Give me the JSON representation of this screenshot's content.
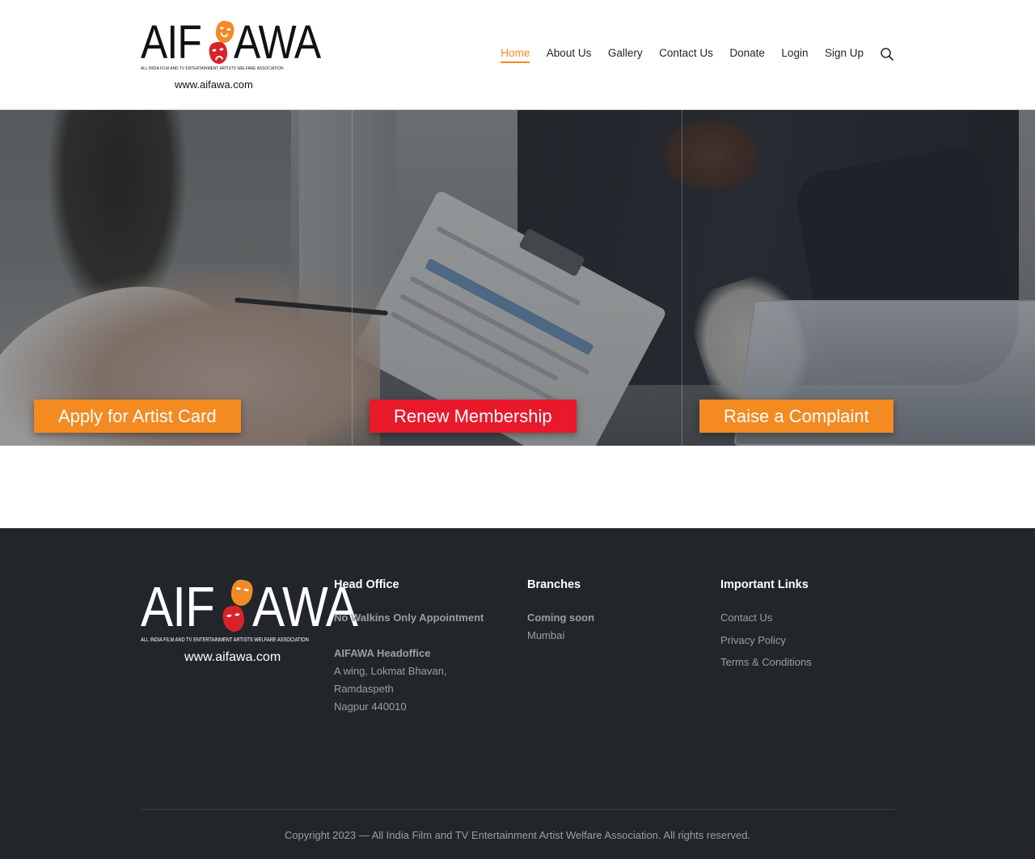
{
  "brand": {
    "logo_left": "AIF",
    "logo_right": "AWA",
    "tagline": "ALL INDIA FILM AND TV ENTERTAINMENT ARTISTS WELFARE ASSOCIATION",
    "url": "www.aifawa.com",
    "mask_colors": [
      "#f28a25",
      "#d8222a"
    ]
  },
  "nav": {
    "items": [
      {
        "label": "Home",
        "active": true
      },
      {
        "label": "About Us"
      },
      {
        "label": "Gallery"
      },
      {
        "label": "Contact Us"
      },
      {
        "label": "Donate"
      },
      {
        "label": "Login"
      },
      {
        "label": "Sign Up"
      }
    ],
    "search_icon": "search-icon",
    "active_color": "#f28a25"
  },
  "hero": {
    "buttons": [
      {
        "label": "Apply for Artist Card",
        "color": "#f38a22"
      },
      {
        "label": "Renew Membership",
        "color": "#e8192b"
      },
      {
        "label": "Raise a Complaint",
        "color": "#f38a22"
      }
    ]
  },
  "footer": {
    "head_office": {
      "title": "Head Office",
      "note": "No Walkins Only Appointment",
      "name": "AIFAWA Headoffice",
      "address": [
        "A wing, Lokmat Bhavan,",
        "Ramdaspeth",
        "Nagpur 440010"
      ]
    },
    "branches": {
      "title": "Branches",
      "status": "Coming soon",
      "city": "Mumbai"
    },
    "links": {
      "title": "Important Links",
      "items": [
        "Contact Us",
        "Privacy Policy",
        "Terms & Conditions"
      ]
    },
    "copyright": "Copyright 2023 — All India Film and TV Entertainment Artist Welfare Association. All rights reserved."
  }
}
